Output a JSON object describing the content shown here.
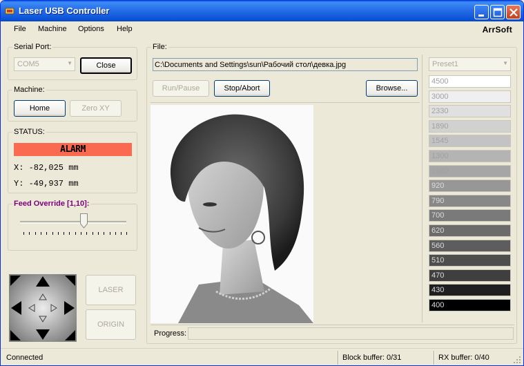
{
  "window": {
    "title": "Laser USB Controller"
  },
  "menu": {
    "items": [
      "File",
      "Machine",
      "Options",
      "Help"
    ],
    "brand": "ArrSoft"
  },
  "serial": {
    "label": "Serial Port:",
    "port": "COM5",
    "close_label": "Close"
  },
  "machine": {
    "label": "Machine:",
    "home_label": "Home",
    "zero_label": "Zero XY"
  },
  "status": {
    "label": "STATUS:",
    "state": "ALARM",
    "x_text": "X:  -82,025  mm",
    "y_text": "Y:  -49,937  mm",
    "alarm_color": "#fa6a50"
  },
  "feed": {
    "label": "Feed Override [1,10]:",
    "value_fraction": 0.6
  },
  "jog": {
    "laser_label": "LASER",
    "origin_label": "ORIGIN"
  },
  "file": {
    "label": "File:",
    "path": "C:\\Documents and Settings\\sun\\Рабочий стол\\девка.jpg",
    "run_label": "Run/Pause",
    "stop_label": "Stop/Abort",
    "browse_label": "Browse..."
  },
  "preset": {
    "selected": "Preset1",
    "values": [
      "4500",
      "3000",
      "2330",
      "1890",
      "1545",
      "1300",
      "1080",
      "920",
      "790",
      "700",
      "620",
      "560",
      "510",
      "470",
      "430",
      "400"
    ],
    "colors": [
      "#ffffff",
      "#efefef",
      "#e0e0e0",
      "#d1d1d1",
      "#c3c3c3",
      "#b4b4b4",
      "#a6a6a6",
      "#979797",
      "#888888",
      "#7a7a7a",
      "#6b6b6b",
      "#5d5d5d",
      "#4e4e4e",
      "#3f3f3f",
      "#1f1f1f",
      "#000000"
    ],
    "text_colors": [
      "#a0a0a0",
      "#a0a0a0",
      "#a0a0a0",
      "#a0a0a0",
      "#a0a0a0",
      "#a0a0a0",
      "#a0a0a0",
      "#dcdcdc",
      "#dcdcdc",
      "#dcdcdc",
      "#dcdcdc",
      "#dcdcdc",
      "#dcdcdc",
      "#dcdcdc",
      "#dcdcdc",
      "#dcdcdc"
    ]
  },
  "progress": {
    "label": "Progress:"
  },
  "statusbar": {
    "connection": "Connected",
    "block_buffer": "Block buffer:  0/31",
    "rx_buffer": "RX buffer:  0/40"
  }
}
